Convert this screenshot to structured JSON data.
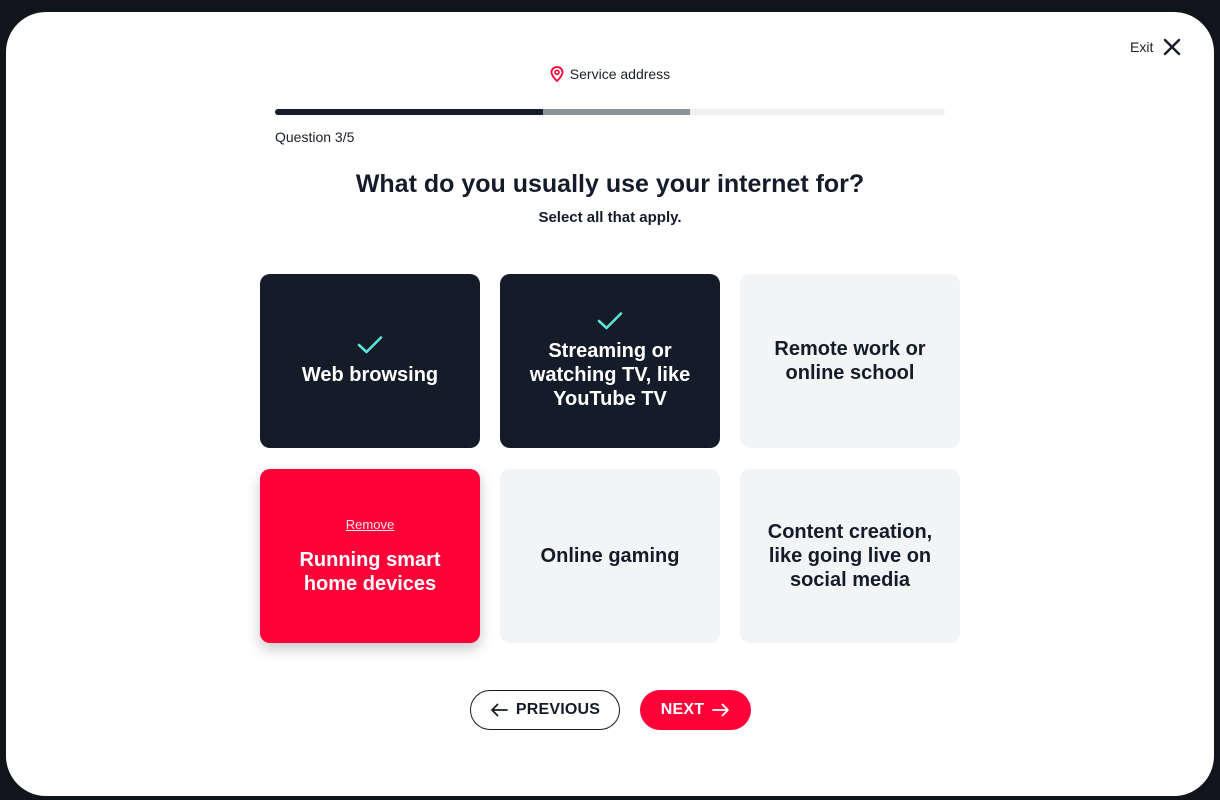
{
  "header": {
    "step_label": "Service address",
    "exit_label": "Exit"
  },
  "progress": {
    "question_label": "Question 3/5",
    "completed_fraction": 0.4,
    "partial_fraction": 0.62
  },
  "question": {
    "title": "What do you usually use your internet for?",
    "subtitle": "Select all that apply."
  },
  "options": [
    {
      "label": "Web browsing",
      "state": "selected"
    },
    {
      "label": "Streaming or watching TV, like YouTube TV",
      "state": "selected"
    },
    {
      "label": "Remote work or online school",
      "state": "unselected"
    },
    {
      "label": "Running smart home devices",
      "state": "hover-remove",
      "remove_label": "Remove"
    },
    {
      "label": "Online gaming",
      "state": "unselected"
    },
    {
      "label": "Content creation, like going live on social media",
      "state": "unselected"
    }
  ],
  "nav": {
    "previous_label": "PREVIOUS",
    "next_label": "NEXT"
  },
  "colors": {
    "accent": "#ff0038",
    "dark": "#141b29",
    "check": "#5ee3d7",
    "card_bg": "#f3f4f5"
  },
  "icons": {
    "exit": "close-icon",
    "step": "map-pin-icon",
    "selected": "check-icon",
    "previous": "arrow-left-icon",
    "next": "arrow-right-icon"
  }
}
